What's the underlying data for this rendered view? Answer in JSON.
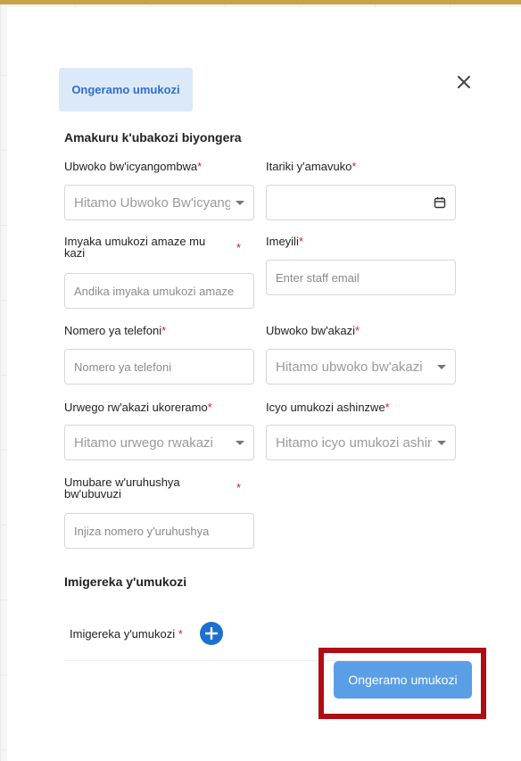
{
  "modal": {
    "title": "Ongeramo umukozi",
    "close_icon": "×",
    "section_staff_info": "Amakuru k'ubakozi biyongera",
    "section_restrictions": "Imigereka y'umukozi",
    "submit_label": "Ongeramo umukozi",
    "accent_color": "#5a9fe6",
    "highlight_color": "#b00d14"
  },
  "fields": {
    "insurance_type": {
      "label": "Ubwoko bw'icyangombwa",
      "placeholder": "Hitamo Ubwoko Bw'icyangombwa"
    },
    "birth_date": {
      "label": "Itariki y'amavuko",
      "value": ""
    },
    "experience": {
      "label": "Imyaka umukozi amaze mu kazi",
      "placeholder": "Andika imyaka umukozi amaze"
    },
    "email": {
      "label": "Imeyili",
      "placeholder": "Enter staff email"
    },
    "phone": {
      "label": "Nomero ya telefoni",
      "placeholder": "Nomero ya telefoni"
    },
    "job_type": {
      "label": "Ubwoko bw'akazi",
      "placeholder": "Hitamo ubwoko bw'akazi"
    },
    "work_level": {
      "label": "Urwego rw'akazi ukoreramo",
      "placeholder": "Hitamo urwego rwakazi"
    },
    "responsibility": {
      "label": "Icyo umukozi ashinzwe",
      "placeholder": "Hitamo icyo umukozi ashinzwe"
    },
    "license_number": {
      "label": "Umubare w'uruhushya bw'ubuvuzi",
      "placeholder": "Injiza nomero y'uruhushya"
    }
  },
  "restrictions": {
    "label": "Imigereka y'umukozi",
    "required_mark": "*",
    "add_icon": "+"
  },
  "required_mark": "*"
}
